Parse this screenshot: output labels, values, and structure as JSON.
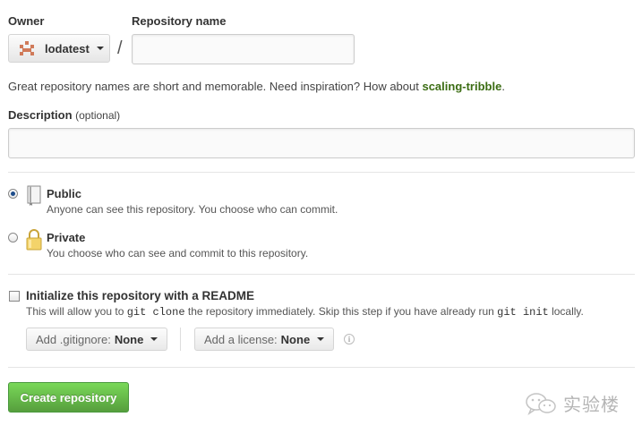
{
  "owner": {
    "label": "Owner",
    "selected": "lodatest"
  },
  "repo_name": {
    "label": "Repository name",
    "value": "",
    "separator": "/"
  },
  "hint": {
    "prefix": "Great repository names are short and memorable. Need inspiration? How about ",
    "suggestion": "scaling-tribble",
    "suffix": "."
  },
  "description": {
    "label": "Description",
    "optional": "(optional)",
    "value": ""
  },
  "visibility": {
    "selected": "public",
    "public": {
      "title": "Public",
      "subtitle": "Anyone can see this repository. You choose who can commit."
    },
    "private": {
      "title": "Private",
      "subtitle": "You choose who can see and commit to this repository."
    }
  },
  "init": {
    "checked": false,
    "title": "Initialize this repository with a README",
    "sub_1": "This will allow you to ",
    "code_1": "git clone",
    "sub_2": " the repository immediately. Skip this step if you have already run ",
    "code_2": "git init",
    "sub_3": " locally."
  },
  "gitignore": {
    "prefix": "Add .gitignore:",
    "value": "None"
  },
  "license": {
    "prefix": "Add a license:",
    "value": "None"
  },
  "create_button": "Create repository",
  "watermark": "实验楼",
  "colors": {
    "link_green": "#3c6d14",
    "button_green": "#60b044",
    "identicon": "#d07a59"
  }
}
